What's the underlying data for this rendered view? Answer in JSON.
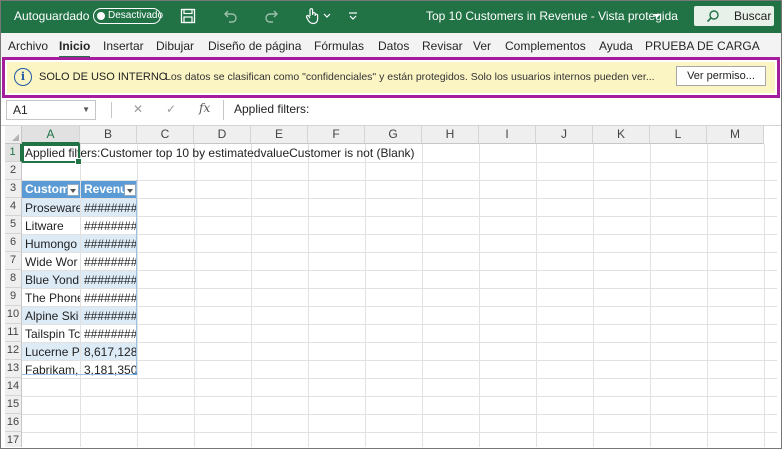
{
  "titlebar": {
    "autosave_label": "Autoguardado",
    "autosave_toggle": "Desactivado",
    "document_title": "Top 10 Customers in Revenue  -  Vista protegida",
    "search_label": "Buscar",
    "accent_color": "#217346"
  },
  "ribbon": {
    "tabs": [
      "Archivo",
      "Inicio",
      "Insertar",
      "Dibujar",
      "Diseño de página",
      "Fórmulas",
      "Datos",
      "Revisar",
      "Ver",
      "Complementos",
      "Ayuda",
      "PRUEBA DE CARGA"
    ],
    "active_tab": "Inicio"
  },
  "infobar": {
    "title": "SOLO DE USO INTERNO",
    "message": "Los datos se clasifican como \"confidenciales\" y están protegidos. Solo los usuarios internos pueden ver...",
    "button_label": "Ver permiso...",
    "highlight_color": "#a51d9d"
  },
  "formula_bar": {
    "name_box": "A1",
    "fx_label": "fx",
    "formula": "Applied filters:"
  },
  "sheet": {
    "columns": [
      "A",
      "B",
      "C",
      "D",
      "E",
      "F",
      "G",
      "H",
      "I",
      "J",
      "K",
      "L",
      "M"
    ],
    "rows": [
      "1",
      "2",
      "3",
      "4",
      "5",
      "6",
      "7",
      "8",
      "9",
      "10",
      "11",
      "12",
      "13",
      "14",
      "15",
      "16",
      "17"
    ],
    "a1_text": "Applied filters:Customer top 10 by estimatedvalueCustomer is not (Blank)",
    "table_headers": [
      "Custom",
      "Revenu"
    ],
    "table_rows": [
      [
        "Proseware",
        "########"
      ],
      [
        "Litware",
        "########"
      ],
      [
        "Humongo",
        "########"
      ],
      [
        "Wide Wor",
        "########"
      ],
      [
        "Blue Yond",
        "########"
      ],
      [
        "The Phone",
        "########"
      ],
      [
        "Alpine Ski",
        "########"
      ],
      [
        "Tailspin Tc",
        "########"
      ],
      [
        "Lucerne P",
        "8,617,128"
      ],
      [
        "Fabrikam,",
        "3,181,350"
      ]
    ],
    "table_header_color": "#5b9bd5",
    "table_band_color": "#ddebf7"
  }
}
